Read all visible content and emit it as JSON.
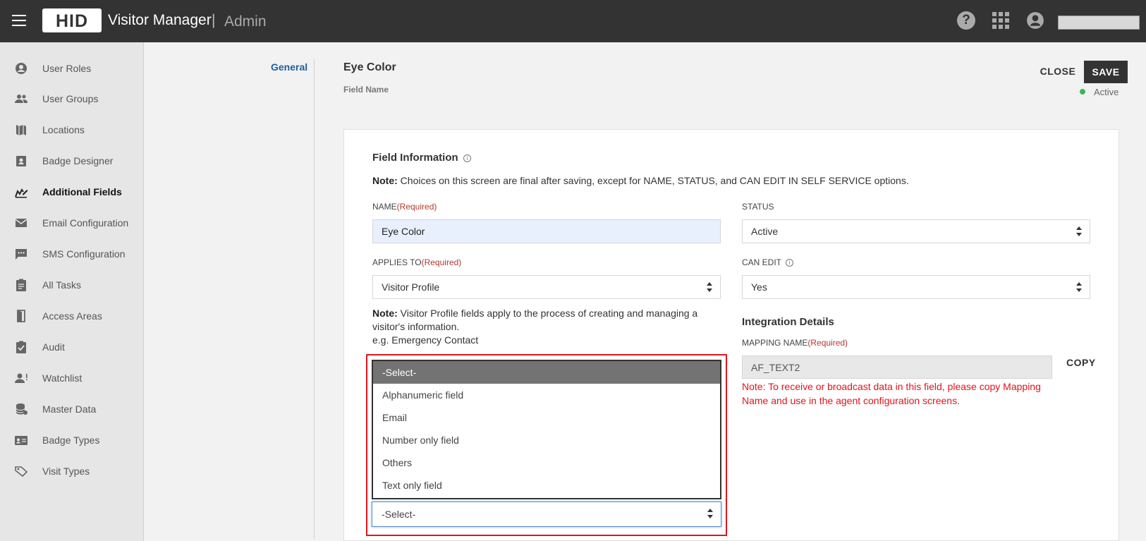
{
  "header": {
    "logo_text": "HID",
    "app_title": "Visitor Manager",
    "separator": "|",
    "app_subtitle": "Admin",
    "help_glyph": "?",
    "icons": [
      "menu-icon",
      "help-icon",
      "apps-grid-icon",
      "account-icon"
    ]
  },
  "sidebar": {
    "items": [
      {
        "label": "User Roles",
        "icon": "account-circle-icon"
      },
      {
        "label": "User Groups",
        "icon": "people-icon"
      },
      {
        "label": "Locations",
        "icon": "map-icon"
      },
      {
        "label": "Badge Designer",
        "icon": "badge-icon"
      },
      {
        "label": "Additional Fields",
        "icon": "edit-fields-icon"
      },
      {
        "label": "Email Configuration",
        "icon": "mail-icon"
      },
      {
        "label": "SMS Configuration",
        "icon": "message-icon"
      },
      {
        "label": "All Tasks",
        "icon": "clipboard-icon"
      },
      {
        "label": "Access Areas",
        "icon": "door-icon"
      },
      {
        "label": "Audit",
        "icon": "checklist-icon"
      },
      {
        "label": "Watchlist",
        "icon": "person-alert-icon"
      },
      {
        "label": "Master Data",
        "icon": "database-icon"
      },
      {
        "label": "Badge Types",
        "icon": "id-card-icon"
      },
      {
        "label": "Visit Types",
        "icon": "tag-icon"
      }
    ],
    "active": "Additional Fields"
  },
  "tabs": {
    "general": "General"
  },
  "page": {
    "title": "Eye Color",
    "subtitle": "Field Name",
    "close_label": "CLOSE",
    "save_label": "SAVE",
    "status": "Active",
    "status_color": "#3bb55c"
  },
  "form": {
    "section_title": "Field Information",
    "info_glyph": "i",
    "note_prefix": "Note:",
    "note_text": " Choices on this screen are final after saving, except for NAME, STATUS, and CAN EDIT IN SELF SERVICE options.",
    "name_label": "NAME",
    "required": "(Required)",
    "name_value": "Eye Color",
    "status_label": "STATUS",
    "status_value": "Active",
    "applies_label": "APPLIES TO",
    "applies_value": "Visitor Profile",
    "can_edit_label": "CAN EDIT",
    "can_edit_value": "Yes",
    "vp_note_prefix": "Note:",
    "vp_note_text": " Visitor Profile fields apply to the process of creating and managing a visitor's information.",
    "vp_example": "e.g. Emergency Contact",
    "integration_title": "Integration Details",
    "mapping_label": "MAPPING NAME",
    "mapping_value": "AF_TEXT2",
    "copy_label": "COPY",
    "mapping_note": "Note: To receive or broadcast data in this field, please copy Mapping Name and use in the agent configuration screens."
  },
  "dropdown": {
    "options": [
      "-Select-",
      "Alphanumeric field",
      "Email",
      "Number only field",
      "Others",
      "Text only field"
    ],
    "selected": "-Select-",
    "value": "-Select-",
    "highlight_color": "#e3141c"
  }
}
